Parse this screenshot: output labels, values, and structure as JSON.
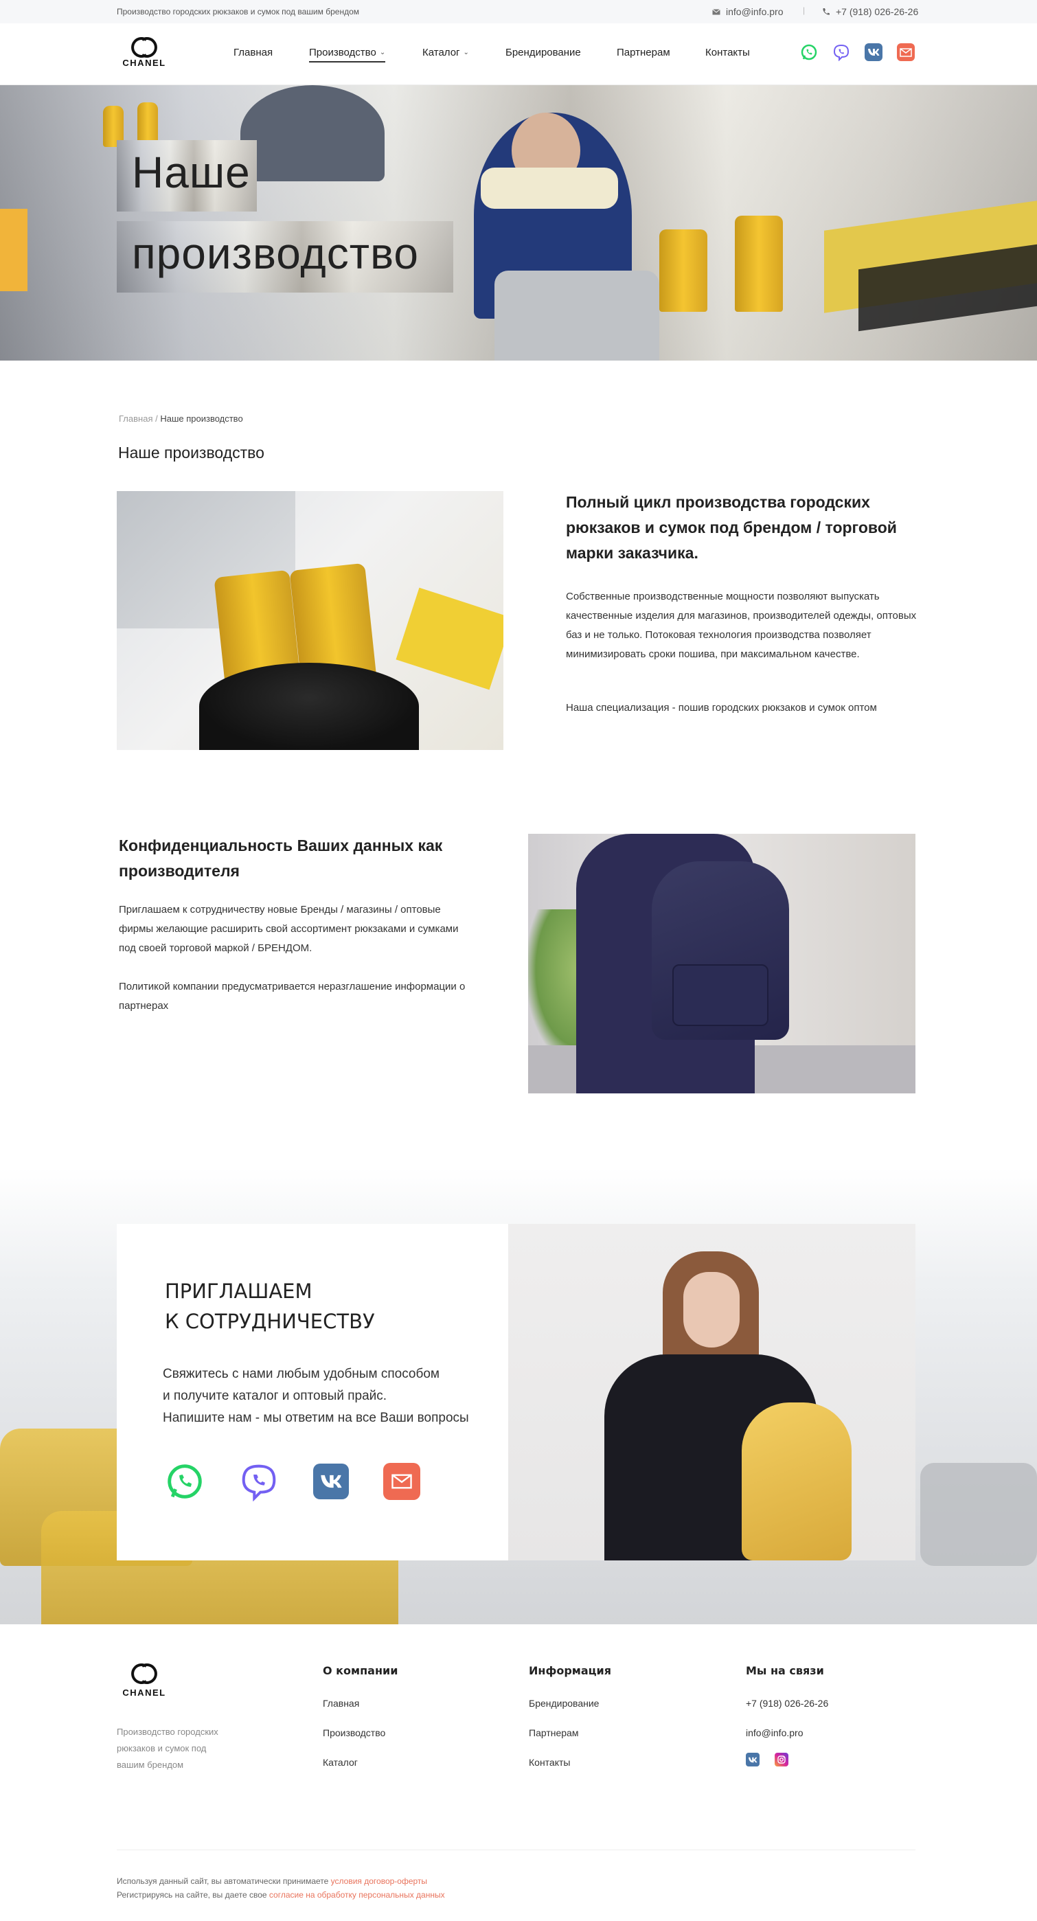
{
  "topbar": {
    "tagline": "Производство городских рюкзаков и сумок под вашим брендом",
    "email": "info@info.pro",
    "separator": "|",
    "phone": "+7 (918) 026-26-26"
  },
  "brand": {
    "logo_text": "CHANEL"
  },
  "nav": {
    "items": [
      {
        "label": "Главная"
      },
      {
        "label": "Производство"
      },
      {
        "label": "Каталог"
      },
      {
        "label": "Брендирование"
      },
      {
        "label": "Партнерам"
      },
      {
        "label": "Контакты"
      }
    ],
    "dropdown_glyph": "⌄"
  },
  "social_icons": [
    "whatsapp-icon",
    "viber-icon",
    "vk-icon",
    "mail-icon"
  ],
  "hero": {
    "line1": "Наше",
    "line2": "производство"
  },
  "breadcrumb": {
    "home": "Главная",
    "separator": " / ",
    "current": "Наше производство"
  },
  "page_title": "Наше производство",
  "section1": {
    "heading": "Полный цикл производства городских рюкзаков и сумок под брендом / торговой марки заказчика.",
    "paragraph": "Собственные производственные мощности позволяют выпускать качественные изделия для магазинов, производителей одежды, оптовых баз и не только. Потоковая технология производства позволяет минимизировать сроки пошива, при максимальном качестве.",
    "paragraph2": "Наша специализация - пошив городских рюкзаков и сумок оптом"
  },
  "section2": {
    "heading": "Конфиденциальность Ваших данных как производителя",
    "paragraph": "Приглашаем к сотрудничеству новые Бренды / магазины / оптовые фирмы желающие расширить свой ассортимент рюкзаками и сумками под своей торговой маркой / БРЕНДОМ.",
    "paragraph2": "Политикой компании предусматривается неразглашение информации о партнерах"
  },
  "section3": {
    "heading_line1": "Приглашаем",
    "heading_line2": "к сотрудничеству",
    "text_line1": "Свяжитесь с нами любым удобным способом",
    "text_line2": "и получите каталог и оптовый прайс.",
    "text_line3": "Напишите нам - мы ответим на все Ваши вопросы"
  },
  "footer": {
    "description": "Производство городских рюкзаков и сумок под вашим брендом",
    "col1": {
      "heading": "О компании",
      "links": [
        "Главная",
        "Производство",
        "Каталог"
      ]
    },
    "col2": {
      "heading": "Информация",
      "links": [
        "Брендирование",
        "Партнерам",
        "Контакты"
      ]
    },
    "col3": {
      "heading": "Мы на связи",
      "phone": "+7 (918) 026-26-26",
      "email": "info@info.pro"
    },
    "legal_line1_text": "Используя данный сайт, вы автоматически принимаете ",
    "legal_line1_link": "условия договор-оферты",
    "legal_line2_text": "Регистрируясь на сайте, вы даете свое ",
    "legal_line2_link": "согласие на обработку персональных данных"
  },
  "colors": {
    "whatsapp": "#25d366",
    "viber": "#7360f2",
    "vk": "#4a76a8",
    "mail": "#ef6a52",
    "instagram": "#d6249f",
    "link_accent": "#e8735c"
  }
}
